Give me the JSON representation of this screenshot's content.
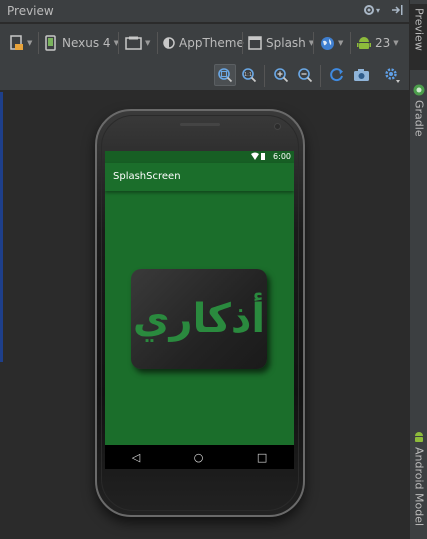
{
  "header": {
    "title": "Preview"
  },
  "toolbar": {
    "device": "Nexus 4",
    "theme": "AppTheme",
    "activity": "Splash",
    "api_level": "23"
  },
  "strip": {
    "preview_label": "Preview",
    "gradle_label": "Gradle",
    "android_model_label": "Android Model"
  },
  "device_screen": {
    "status_time": "6:00",
    "app_title": "SplashScreen",
    "logo_text": "أذكاري"
  },
  "colors": {
    "ide_bg": "#2b2b2b",
    "ide_panel": "#3c3f41",
    "app_green": "#1b6e2b",
    "logo_green": "#2a8a3e"
  }
}
